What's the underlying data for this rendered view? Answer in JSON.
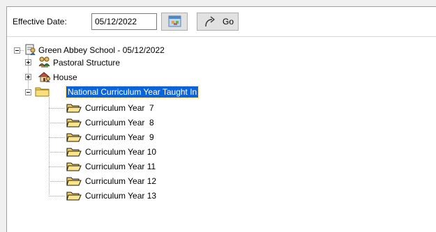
{
  "toolbar": {
    "effective_date_label": "Effective Date:",
    "effective_date_value": "05/12/2022",
    "calendar_icon": "calendar-icon",
    "go_label": "Go",
    "go_icon": "arrow-redo-icon"
  },
  "tree": {
    "root": {
      "label": "Green Abbey School - 05/12/2022",
      "icon": "school-structure-icon",
      "expanded": true
    },
    "children": [
      {
        "label": "Pastoral Structure",
        "icon": "pastoral-icon",
        "expanded": false
      },
      {
        "label": "House",
        "icon": "house-icon",
        "expanded": false
      },
      {
        "label": "National Curriculum Year Taught In",
        "icon": "folder-icon",
        "expanded": true,
        "selected": true,
        "children": [
          {
            "label": "Curriculum Year  7",
            "icon": "open-folder-icon"
          },
          {
            "label": "Curriculum Year  8",
            "icon": "open-folder-icon"
          },
          {
            "label": "Curriculum Year  9",
            "icon": "open-folder-icon"
          },
          {
            "label": "Curriculum Year 10",
            "icon": "open-folder-icon"
          },
          {
            "label": "Curriculum Year 11",
            "icon": "open-folder-icon"
          },
          {
            "label": "Curriculum Year 12",
            "icon": "open-folder-icon"
          },
          {
            "label": "Curriculum Year 13",
            "icon": "open-folder-icon"
          }
        ]
      }
    ]
  },
  "colors": {
    "selection": "#0a64d8",
    "folder": "#f6d25a",
    "folder_border": "#9a7a10"
  }
}
